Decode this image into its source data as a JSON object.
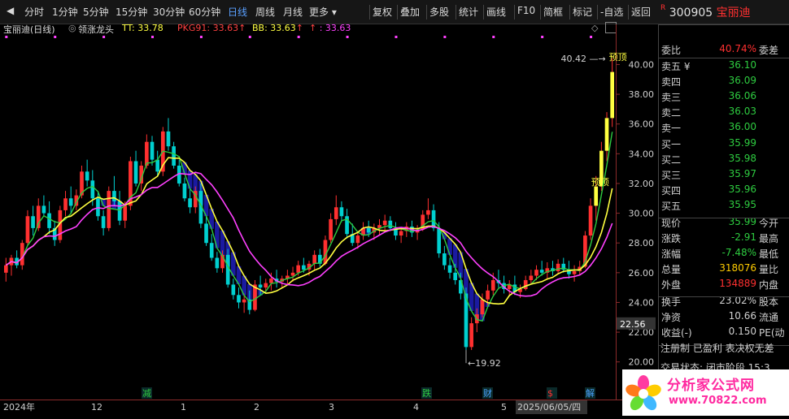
{
  "toolbar": {
    "periods": [
      "分时",
      "1分钟",
      "5分钟",
      "15分钟",
      "30分钟",
      "60分钟",
      "日线",
      "周线",
      "月线",
      "更多"
    ],
    "active": "日线",
    "tools": [
      "复权",
      "叠加",
      "多股",
      "统计",
      "画线",
      "F10",
      "简框",
      "标记",
      "-自选",
      "返回"
    ]
  },
  "stock": {
    "code": "300905",
    "name": "宝丽迪",
    "flag": "R"
  },
  "indicator": {
    "name": "宝丽迪(日线)",
    "formula": "领涨龙头",
    "tt_label": "TT: 33.78",
    "pkg_label": "PKG91: 33.63",
    "bb_label": "BB: 33.63",
    "extra_label": ": 33.63",
    "arrow": "↑"
  },
  "annotations": {
    "high": "40.42",
    "low": "19.92",
    "peak_label": "预顶",
    "mid_label": "预顶",
    "price_tag": "22.56"
  },
  "xaxis": {
    "labels": [
      "2024年",
      "12",
      "1",
      "2",
      "3",
      "4",
      "5",
      "2025/06/05/四"
    ],
    "events": [
      {
        "text": "减",
        "color": "#2ecc40"
      },
      {
        "text": "跌",
        "color": "#2ecc40"
      },
      {
        "text": "财",
        "color": "#4aa3ff"
      },
      {
        "text": "$",
        "color": "#ff3030"
      },
      {
        "text": "解",
        "color": "#4aa3ff"
      }
    ]
  },
  "colors": {
    "up": "#ff3030",
    "down": "#00d0d0",
    "tt": "#ffff40",
    "ma": "#ff40ff",
    "green": "#2ecc40",
    "fill": "#1a1aa0"
  },
  "chart_data": {
    "type": "candlestick",
    "yticks": [
      20,
      22,
      24,
      26,
      28,
      30,
      32,
      34,
      36,
      38,
      40
    ],
    "ylim": [
      19.0,
      41.5
    ],
    "grid": false,
    "candles": [
      [
        26,
        27,
        25.4,
        26.5
      ],
      [
        26.5,
        27.2,
        25.8,
        27
      ],
      [
        27,
        27.5,
        26.3,
        26.5
      ],
      [
        26.5,
        28.2,
        26.2,
        28
      ],
      [
        28,
        30.2,
        27.8,
        29.8
      ],
      [
        29.8,
        30.5,
        28.5,
        29
      ],
      [
        29,
        31,
        28.8,
        30.5
      ],
      [
        30.5,
        31.2,
        29.8,
        30
      ],
      [
        30,
        30.8,
        28.6,
        29
      ],
      [
        29,
        29.5,
        27.8,
        28.2
      ],
      [
        28.2,
        30.5,
        28,
        30.2
      ],
      [
        30.2,
        31.5,
        29.8,
        31
      ],
      [
        31,
        31.8,
        30,
        30.5
      ],
      [
        30.5,
        31.6,
        30.2,
        31.2
      ],
      [
        31.2,
        33.2,
        31,
        32.8
      ],
      [
        32.8,
        33.6,
        31.8,
        32.2
      ],
      [
        32.2,
        32.9,
        30.5,
        31
      ],
      [
        31,
        31.5,
        29.5,
        29.8
      ],
      [
        29.8,
        30.2,
        28.5,
        29
      ],
      [
        29,
        31.8,
        28.8,
        31.5
      ],
      [
        31.5,
        32.5,
        30.5,
        30.8
      ],
      [
        30.8,
        31.5,
        29.2,
        29.5
      ],
      [
        29.5,
        30.8,
        29,
        30.5
      ],
      [
        30.5,
        33.8,
        30.2,
        33.5
      ],
      [
        33.5,
        34.2,
        31.8,
        32
      ],
      [
        32,
        33.5,
        31.5,
        33.2
      ],
      [
        33.2,
        35.3,
        33,
        34.8
      ],
      [
        34.8,
        35.2,
        33.2,
        33.6
      ],
      [
        33.6,
        34.2,
        32.5,
        32.8
      ],
      [
        32.8,
        35.8,
        32.5,
        35.5
      ],
      [
        35.5,
        36.4,
        34.2,
        34.5
      ],
      [
        34.5,
        34.8,
        33,
        33.2
      ],
      [
        33.2,
        33.6,
        31.8,
        32
      ],
      [
        32,
        32.4,
        30.8,
        31
      ],
      [
        31,
        31.6,
        30,
        30.4
      ],
      [
        30.4,
        31.8,
        30,
        31.5
      ],
      [
        31.5,
        32,
        29,
        29.3
      ],
      [
        29.3,
        29.8,
        27.8,
        28
      ],
      [
        28,
        28.6,
        26.8,
        27
      ],
      [
        27,
        27.4,
        26,
        26.3
      ],
      [
        26.3,
        27.5,
        26,
        27.2
      ],
      [
        27.2,
        27.6,
        25,
        25.2
      ],
      [
        25.2,
        25.6,
        24.2,
        24.5
      ],
      [
        24.5,
        25,
        23.6,
        24
      ],
      [
        24,
        24.6,
        23.3,
        24.2
      ],
      [
        24.2,
        24.8,
        23.2,
        23.5
      ],
      [
        23.5,
        25.5,
        23.4,
        25.2
      ],
      [
        25.2,
        25.8,
        24.5,
        25
      ],
      [
        25,
        25.6,
        24.6,
        25.3
      ],
      [
        25.3,
        26,
        24.8,
        25.6
      ],
      [
        25.6,
        26.2,
        25,
        25.4
      ],
      [
        25.4,
        25.8,
        25,
        25.6
      ],
      [
        25.6,
        26.2,
        25.2,
        25.8
      ],
      [
        25.8,
        26.4,
        25.4,
        26
      ],
      [
        26,
        26.8,
        25.8,
        26.5
      ],
      [
        26.5,
        27,
        26,
        26.2
      ],
      [
        26.2,
        26.8,
        25.8,
        26.6
      ],
      [
        26.6,
        27.5,
        26.2,
        27.2
      ],
      [
        27.2,
        27.6,
        26.4,
        26.6
      ],
      [
        26.6,
        28.5,
        26.5,
        28.2
      ],
      [
        28.2,
        30,
        28,
        29.6
      ],
      [
        29.6,
        31.2,
        29.2,
        30.4
      ],
      [
        30.4,
        30.8,
        29.4,
        29.8
      ],
      [
        29.8,
        30.3,
        28.3,
        28.6
      ],
      [
        28.6,
        29.3,
        27.8,
        28
      ],
      [
        28,
        28.8,
        27.6,
        28.5
      ],
      [
        28.5,
        29.4,
        28.2,
        29
      ],
      [
        29,
        29.5,
        28.4,
        28.7
      ],
      [
        28.7,
        29.3,
        28.2,
        29
      ],
      [
        29,
        29.6,
        28.5,
        29.2
      ],
      [
        29.2,
        29.9,
        28.8,
        29.5
      ],
      [
        29.5,
        29.8,
        28.8,
        29
      ],
      [
        29,
        29.4,
        28.2,
        28.5
      ],
      [
        28.5,
        29,
        28,
        28.8
      ],
      [
        28.8,
        29.4,
        28.4,
        29.1
      ],
      [
        29.1,
        29.5,
        28.4,
        28.7
      ],
      [
        28.7,
        29.2,
        28.2,
        28.9
      ],
      [
        28.9,
        30.2,
        28.8,
        29.9
      ],
      [
        29.9,
        31,
        29.6,
        30.2
      ],
      [
        30.2,
        30.6,
        28.8,
        29
      ],
      [
        29,
        29.4,
        27,
        27.3
      ],
      [
        27.3,
        27.8,
        26.2,
        26.5
      ],
      [
        26.5,
        27,
        25.6,
        26
      ],
      [
        26,
        26.6,
        25.2,
        25.5
      ],
      [
        25.5,
        26,
        24.2,
        24.6
      ],
      [
        24.6,
        25,
        20.8,
        21
      ],
      [
        21,
        23,
        20.8,
        22.6
      ],
      [
        22.6,
        23.6,
        22,
        23.2
      ],
      [
        23.2,
        24.6,
        23,
        24.2
      ],
      [
        24.2,
        25.2,
        23.8,
        24.8
      ],
      [
        24.8,
        26,
        24.5,
        25.5
      ],
      [
        25.5,
        26.2,
        25,
        25.3
      ],
      [
        25.3,
        25.8,
        24.6,
        24.9
      ],
      [
        24.9,
        25.5,
        24.4,
        25.2
      ],
      [
        25.2,
        25.8,
        24.5,
        24.7
      ],
      [
        24.7,
        25.2,
        24.3,
        24.9
      ],
      [
        24.9,
        25.8,
        24.8,
        25.5
      ],
      [
        25.5,
        26.2,
        25.2,
        25.8
      ],
      [
        25.8,
        26.5,
        25.5,
        26.2
      ],
      [
        26.2,
        26.8,
        25.8,
        26
      ],
      [
        26,
        26.7,
        25.6,
        26.3
      ],
      [
        26.3,
        26.8,
        25.8,
        26.1
      ],
      [
        26.1,
        26.9,
        25.9,
        26.6
      ],
      [
        26.6,
        27,
        26,
        26.2
      ],
      [
        26.2,
        26.8,
        25.6,
        25.9
      ],
      [
        25.9,
        26.5,
        25.4,
        26.1
      ],
      [
        26.1,
        26.8,
        25.8,
        26.4
      ],
      [
        26.4,
        28.8,
        26.3,
        28.5
      ],
      [
        28.5,
        31,
        28.2,
        30.5
      ],
      [
        30.5,
        32.5,
        29.5,
        31.8
      ],
      [
        31.8,
        34.8,
        31.5,
        34.2
      ],
      [
        34.2,
        36.8,
        33.5,
        36.4
      ],
      [
        36.4,
        40.42,
        35.8,
        39.5
      ]
    ]
  }
}
